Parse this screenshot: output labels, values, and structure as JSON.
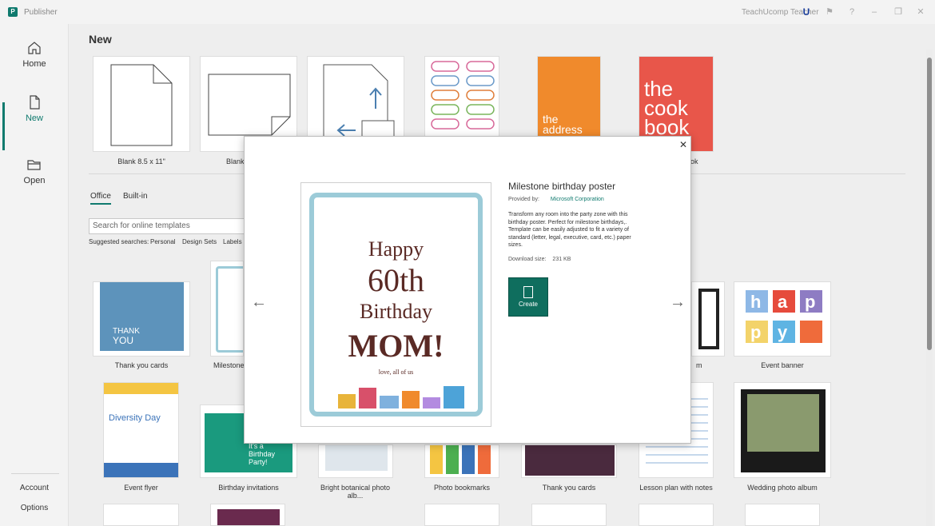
{
  "app": {
    "title": "Publisher",
    "user": "TeachUcomp Teacher",
    "user_badge": "U"
  },
  "nav": {
    "home": "Home",
    "new": "New",
    "open": "Open",
    "account": "Account",
    "options": "Options"
  },
  "main": {
    "heading": "New",
    "blank_tiles": [
      {
        "label": "Blank 8.5 x 11\""
      },
      {
        "label": "Blank"
      }
    ],
    "tabs": {
      "office": "Office",
      "builtin": "Built-in"
    },
    "search_placeholder": "Search for online templates",
    "suggested_label": "Suggested searches:",
    "suggested": [
      "Personal",
      "Design Sets",
      "Labels"
    ],
    "top_partial_label": "ok",
    "cookbook": {
      "line1": "the",
      "line2": "cook",
      "line3": "book"
    },
    "address": {
      "line1": "the",
      "line2": "address"
    },
    "row2": [
      {
        "label": "Thank you cards"
      },
      {
        "label": "Milestone b"
      },
      {
        "label": "m"
      },
      {
        "label": "Event banner"
      }
    ],
    "row3": [
      {
        "label": "Event flyer"
      },
      {
        "label": "Birthday invitations"
      },
      {
        "label": "Bright botanical photo alb..."
      },
      {
        "label": "Photo bookmarks"
      },
      {
        "label": "Thank you cards"
      },
      {
        "label": "Lesson plan with notes"
      },
      {
        "label": "Wedding photo album"
      }
    ],
    "thankyou_tile": {
      "line1": "THANK",
      "line2": "YOU"
    },
    "diversity_tile": "Diversity Day",
    "birthday_tile": {
      "line1": "It's a",
      "line2": "Birthday",
      "line3": "Party!"
    },
    "event_banner_letters": [
      "h",
      "a",
      "p",
      "p",
      "y",
      ""
    ]
  },
  "modal": {
    "title": "Milestone birthday poster",
    "provided_by_label": "Provided by:",
    "provider": "Microsoft Corporation",
    "description": "Transform any room into the party zone with this birthday poster. Perfect for milestone birthdays,. Template can be easily adjusted to fit a variety of standard (letter, legal, executive, card, etc.) paper sizes.",
    "download_label": "Download size:",
    "download_size": "231 KB",
    "create_label": "Create",
    "poster": {
      "line1": "Happy",
      "line2": "60th",
      "line3": "Birthday",
      "line4": "MOM!",
      "sign": "love, all of us"
    }
  },
  "colors": {
    "accent": "#0f7a6e",
    "create_button": "#0f6e5e",
    "poster_text": "#5a2a25",
    "poster_border": "#9ccbd8",
    "cookbook_bg": "#e8564a",
    "address_bg": "#f08a2c"
  }
}
